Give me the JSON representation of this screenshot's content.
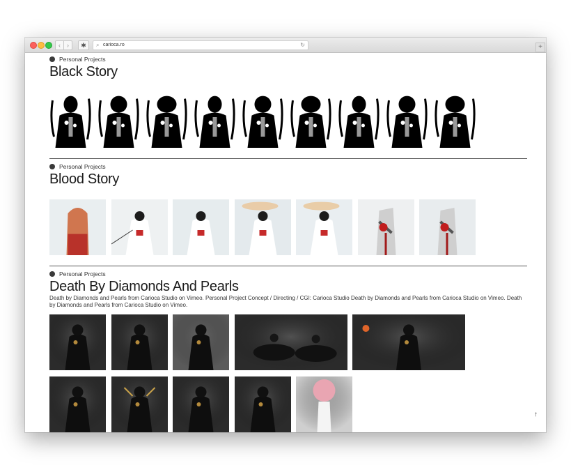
{
  "browser": {
    "url": "carioca.ro"
  },
  "sections": [
    {
      "category": "Personal Projects",
      "title": "Black Story"
    },
    {
      "category": "Personal Projects",
      "title": "Blood Story"
    },
    {
      "category": "Personal Projects",
      "title": "Death By Diamonds And Pearls",
      "description": "Death by Diamonds and Pearls from Carioca Studio on Vimeo. Personal Project Concept / Directing / CGI: Carioca Studio Death by Diamonds and Pearls from Carioca Studio on Vimeo. Death by Diamonds and Pearls from Carioca Studio on Vimeo."
    }
  ],
  "icons": {
    "scroll_top": "arrow-up-icon",
    "nav_back": "chevron-left-icon",
    "nav_forward": "chevron-right-icon"
  }
}
